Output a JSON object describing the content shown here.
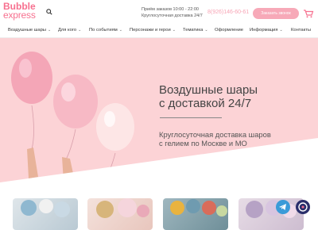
{
  "logo": {
    "line1": "Bubble",
    "line2": "express"
  },
  "header": {
    "hours": "Приём заказов 10:00 - 22:00",
    "delivery": "Круглосуточная доставка 24/7",
    "phone": "8(926)146-60-61",
    "call_button": "Заказать звонок"
  },
  "nav": [
    {
      "label": "Воздушные шары",
      "has_dropdown": true
    },
    {
      "label": "Для кого",
      "has_dropdown": true
    },
    {
      "label": "По событиям",
      "has_dropdown": true
    },
    {
      "label": "Персонажи и герои",
      "has_dropdown": true
    },
    {
      "label": "Тематика",
      "has_dropdown": true
    },
    {
      "label": "Оформление",
      "has_dropdown": false
    },
    {
      "label": "Информация",
      "has_dropdown": true
    },
    {
      "label": "Контакты",
      "has_dropdown": false
    }
  ],
  "hero": {
    "title_line1": "Воздушные шары",
    "title_line2": "с доставкой 24/7",
    "subtitle_line1": "Круглосуточная доставка шаров",
    "subtitle_line2": "с гелием по Москве и МО"
  },
  "colors": {
    "brand": "#f7708f",
    "hero_bg": "#fcd3d6",
    "button": "#f7a9b8"
  },
  "icons": [
    "search-icon",
    "cart-icon",
    "telegram-icon",
    "chat-icon"
  ]
}
